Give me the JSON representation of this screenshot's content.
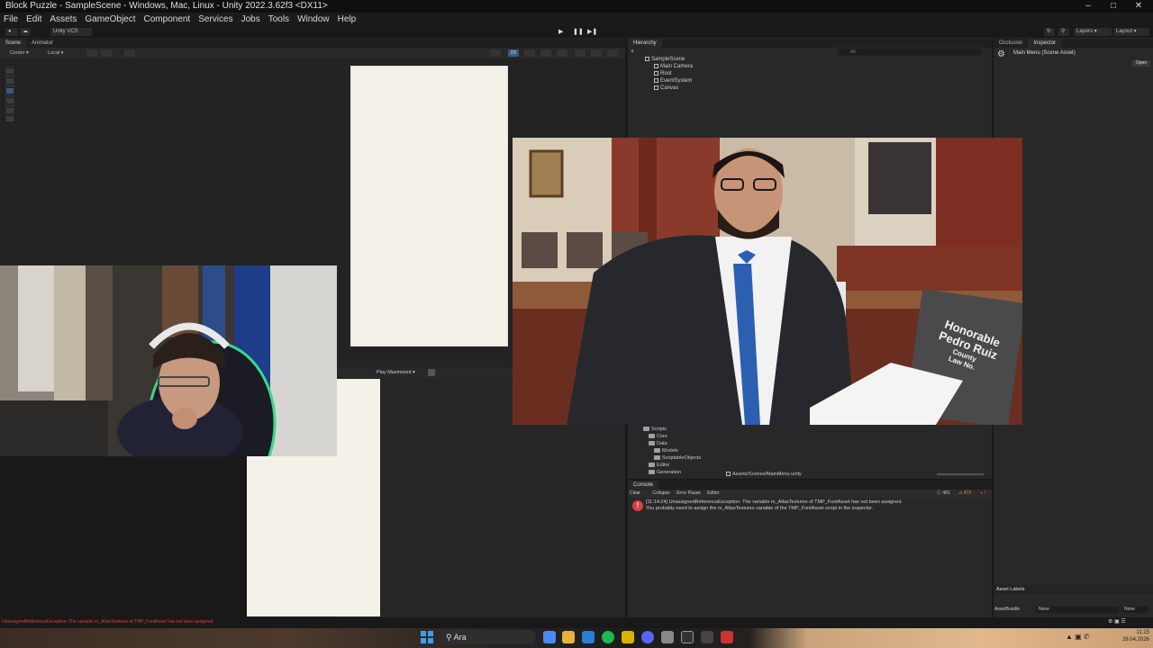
{
  "window": {
    "title": "Block Puzzle - SampleScene - Windows, Mac, Linux - Unity 2022.3.62f3 <DX11>"
  },
  "menu": [
    "File",
    "Edit",
    "Assets",
    "GameObject",
    "Component",
    "Services",
    "Jobs",
    "Tools",
    "Window",
    "Help"
  ],
  "toolbar": {
    "vcs_label": "Unity VCS",
    "layers_label": "Layers",
    "layout_label": "Layout"
  },
  "scene_panel": {
    "tabs": [
      "Scene",
      "Animator"
    ],
    "pivot_label": "Center",
    "space_label": "Local",
    "mode_2d": "2D"
  },
  "game_panel": {
    "play_mode_label": "Play Maximized"
  },
  "hierarchy": {
    "tab": "Hierarchy",
    "search_placeholder": "All",
    "scene_name": "SampleScene",
    "items": [
      "Main Camera",
      "Root",
      "EventSystem",
      "Canvas"
    ]
  },
  "inspector": {
    "tabs": [
      "Occlusion",
      "Inspector"
    ],
    "asset_title": "Main Menu (Scene Asset)",
    "open_button": "Open",
    "asset_labels": "Asset Labels",
    "asset_bundle_label": "AssetBundle",
    "asset_bundle_value": "None",
    "asset_variant_value": "None"
  },
  "project": {
    "tree": [
      "Scripts",
      "Core",
      "Data",
      "Models",
      "ScriptableObjects",
      "Editor",
      "Generation"
    ],
    "path": "Assets/Scenes/MainMenu.unity"
  },
  "console": {
    "tab": "Console",
    "buttons": [
      "Clear",
      "Collapse",
      "Error Pause",
      "Editor"
    ],
    "counts": {
      "logs": "481",
      "warnings": "472",
      "errors": "1"
    },
    "message_line1": "[11:14:24] UnassignedReferenceException: The variable m_AtlasTextures of TMP_FontAsset has not been assigned.",
    "message_line2": "You probably need to assign the m_AtlasTextures variable of the TMP_FontAsset script in the inspector.",
    "status_bar": "UnassignedReferenceException: The variable m_AtlasTextures of TMP_FontAsset has not been assigned."
  },
  "overlay": {
    "nameplate_line1": "Honorable",
    "nameplate_line2": "Pedro Ruiz",
    "nameplate_line3": "County",
    "nameplate_line4": "Law No."
  },
  "taskbar": {
    "search_text": "Ara",
    "time": "11:15",
    "date": "29.04.2026"
  },
  "colors": {
    "editor_bg": "#282828",
    "error": "#d94040",
    "warning": "#e0a020",
    "cream": "#f3f1e8"
  }
}
